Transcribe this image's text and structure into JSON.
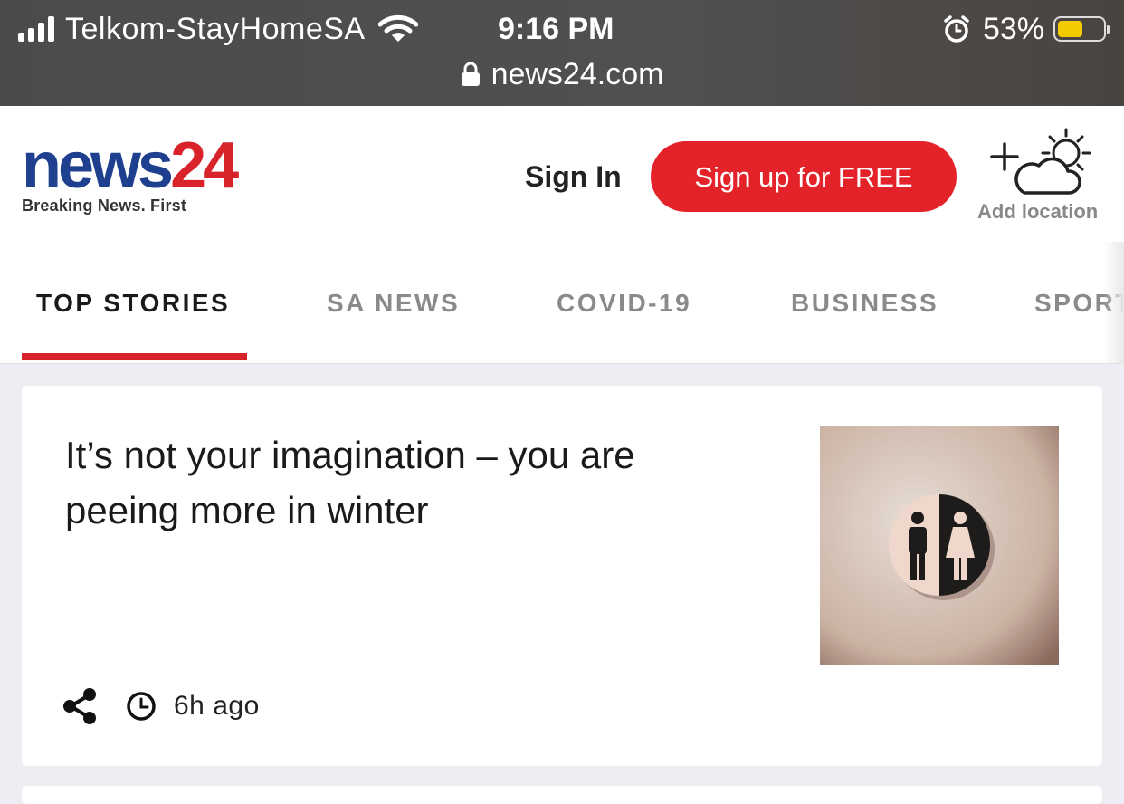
{
  "status_bar": {
    "carrier": "Telkom-StayHomeSA",
    "time": "9:16 PM",
    "battery": "53%",
    "battery_level": 0.53,
    "url": "news24.com",
    "icons": [
      "signal-icon",
      "wifi-icon",
      "alarm-icon",
      "battery-icon",
      "lock-icon"
    ]
  },
  "header": {
    "logo_news": "news",
    "logo_24": "24",
    "tagline": "Breaking News. First",
    "sign_in": "Sign In",
    "sign_up": "Sign up for FREE",
    "add_location": "Add location",
    "brand_colors": {
      "blue": "#1f3f8f",
      "red": "#d8232a"
    }
  },
  "nav": {
    "tabs": [
      {
        "label": "TOP STORIES",
        "active": true
      },
      {
        "label": "SA NEWS",
        "active": false
      },
      {
        "label": "COVID-19",
        "active": false
      },
      {
        "label": "BUSINESS",
        "active": false
      },
      {
        "label": "SPORT",
        "active": false
      }
    ]
  },
  "article": {
    "headline": "It’s not your imagination – you are peeing more in winter",
    "time_ago": "6h ago",
    "icons": [
      "share-icon",
      "clock-icon",
      "restroom-sign-image"
    ]
  }
}
